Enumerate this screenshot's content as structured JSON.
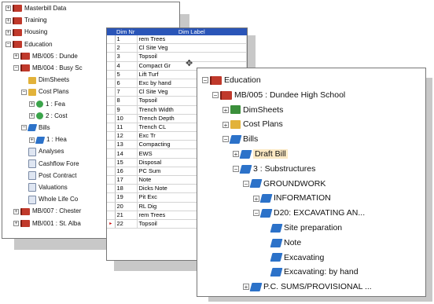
{
  "tree_left": [
    {
      "label": "Masterbill Data",
      "exp": "+",
      "icon": "book",
      "level": 0
    },
    {
      "label": "Training",
      "exp": "+",
      "icon": "book",
      "level": 0
    },
    {
      "label": "Housing",
      "exp": "+",
      "icon": "book",
      "level": 0
    },
    {
      "label": "Education",
      "exp": "−",
      "icon": "book",
      "level": 0
    },
    {
      "label": "MB/005 : Dunde",
      "exp": "+",
      "icon": "book",
      "level": 1
    },
    {
      "label": "MB/004 : Busy Sc",
      "exp": "−",
      "icon": "book",
      "level": 1
    },
    {
      "label": "DimSheets",
      "exp": "",
      "icon": "folder",
      "level": 2
    },
    {
      "label": "Cost Plans",
      "exp": "−",
      "icon": "folder",
      "level": 2
    },
    {
      "label": "1 : Fea",
      "exp": "+",
      "icon": "green",
      "level": 3
    },
    {
      "label": "2 : Cost",
      "exp": "+",
      "icon": "green",
      "level": 3
    },
    {
      "label": "Bills",
      "exp": "−",
      "icon": "blue",
      "level": 2
    },
    {
      "label": "1 : Hea",
      "exp": "+",
      "icon": "blue",
      "level": 3
    },
    {
      "label": "Analyses",
      "exp": "",
      "icon": "doc",
      "level": 2
    },
    {
      "label": "Cashflow Fore",
      "exp": "",
      "icon": "doc",
      "level": 2
    },
    {
      "label": "Post Contract",
      "exp": "",
      "icon": "doc",
      "level": 2
    },
    {
      "label": "Valuations",
      "exp": "",
      "icon": "doc",
      "level": 2
    },
    {
      "label": "Whole Life Co",
      "exp": "",
      "icon": "doc",
      "level": 2
    },
    {
      "label": "MB/007 : Chester",
      "exp": "+",
      "icon": "book",
      "level": 1
    },
    {
      "label": "MB/001 : St. Alba",
      "exp": "+",
      "icon": "book",
      "level": 1
    }
  ],
  "dim_table": {
    "headers": [
      "Dim Nr",
      "Dim Label"
    ],
    "rows": [
      [
        "1",
        "rem Trees"
      ],
      [
        "2",
        "Cl Site Veg"
      ],
      [
        "3",
        "Topsoil"
      ],
      [
        "4",
        "Compact Gr"
      ],
      [
        "5",
        "Lift Turf"
      ],
      [
        "6",
        "Exc by hand"
      ],
      [
        "7",
        "Cl Site Veg"
      ],
      [
        "8",
        "Topsoil"
      ],
      [
        "9",
        "Trench Width"
      ],
      [
        "10",
        "Trench Depth"
      ],
      [
        "11",
        "Trench CL"
      ],
      [
        "12",
        "Exc Tr"
      ],
      [
        "13",
        "Compacting"
      ],
      [
        "14",
        "EWS"
      ],
      [
        "15",
        "Disposal"
      ],
      [
        "16",
        "PC Sum"
      ],
      [
        "17",
        "Note"
      ],
      [
        "18",
        "Dicks Note"
      ],
      [
        "19",
        "Pit Exc"
      ],
      [
        "20",
        "RL Dig"
      ],
      [
        "21",
        "rem Trees"
      ],
      [
        "22",
        "Topsoil"
      ]
    ],
    "current_row_marker": "▸"
  },
  "tree_main": [
    {
      "label": "Education",
      "exp": "−",
      "icon": "book",
      "level": 0
    },
    {
      "label": "MB/005 : Dundee High School",
      "exp": "−",
      "icon": "book",
      "level": 1
    },
    {
      "label": "DimSheets",
      "exp": "+",
      "icon": "sheet",
      "level": 2
    },
    {
      "label": "Cost Plans",
      "exp": "+",
      "icon": "folder",
      "level": 2
    },
    {
      "label": "Bills",
      "exp": "−",
      "icon": "blue",
      "level": 2
    },
    {
      "label": "Draft Bill",
      "exp": "+",
      "icon": "blue",
      "level": 3
    },
    {
      "label": "3 : Substructures",
      "exp": "−",
      "icon": "blue",
      "level": 3
    },
    {
      "label": "GROUNDWORK",
      "exp": "−",
      "icon": "blue",
      "level": 4
    },
    {
      "label": "INFORMATION",
      "exp": "+",
      "icon": "blue",
      "level": 5
    },
    {
      "label": "D20: EXCAVATING AN...",
      "exp": "−",
      "icon": "blue",
      "level": 5
    },
    {
      "label": "Site preparation",
      "exp": "",
      "icon": "blue",
      "level": 6
    },
    {
      "label": "Note",
      "exp": "",
      "icon": "blue",
      "level": 6
    },
    {
      "label": "Excavating",
      "exp": "",
      "icon": "blue",
      "level": 6
    },
    {
      "label": "Excavating: by hand",
      "exp": "",
      "icon": "blue",
      "level": 6
    },
    {
      "label": "P.C. SUMS/PROVISIONAL ...",
      "exp": "+",
      "icon": "blue",
      "level": 4
    }
  ]
}
